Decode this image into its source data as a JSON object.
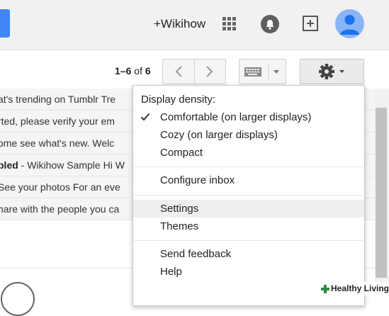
{
  "header": {
    "user_link": "+Wikihow",
    "icons": [
      "apps-grid-icon",
      "notifications-bell-icon",
      "share-plus-icon",
      "account-avatar-icon"
    ]
  },
  "toolbar": {
    "pager": {
      "start": "1",
      "dash": "–",
      "end": "6",
      "of": "of",
      "total": "6"
    },
    "icons": [
      "chevron-left-icon",
      "chevron-right-icon",
      "keyboard-icon",
      "dropdown-arrow-icon",
      "gear-icon"
    ]
  },
  "emails": [
    {
      "text": "at's trending on Tumblr Tre"
    },
    {
      "text": "rted, please verify your em"
    },
    {
      "text": "ome see what's new. Welc"
    },
    {
      "subject": "pled",
      "text": " - Wikihow Sample Hi W"
    },
    {
      "text": "See your photos For an eve"
    },
    {
      "text": "hare with the people you ca"
    }
  ],
  "settings_menu": {
    "section_title": "Display density:",
    "density_options": [
      {
        "label": "Comfortable (on larger displays)",
        "checked": true
      },
      {
        "label": "Cozy (on larger displays)",
        "checked": false
      },
      {
        "label": "Compact",
        "checked": false
      }
    ],
    "configure_inbox": "Configure inbox",
    "settings": "Settings",
    "themes": "Themes",
    "send_feedback": "Send feedback",
    "help": "Help",
    "highlighted_item": "Settings"
  },
  "watermark": {
    "text": "Healthy Living"
  },
  "colors": {
    "accent_blue": "#4285f4",
    "avatar_bg": "#8ab4f8",
    "watermark_green": "#2e8b3e"
  }
}
